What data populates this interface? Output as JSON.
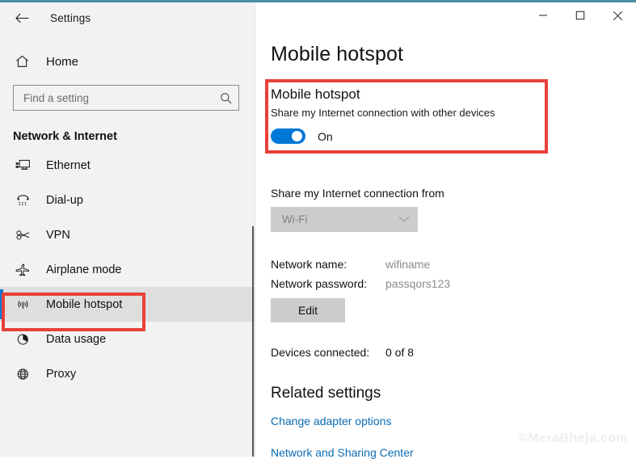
{
  "window": {
    "accent_color": "#4a90a4",
    "app_title": "Settings",
    "back_icon": "back-arrow-icon",
    "controls": {
      "minimize": "minimize-icon",
      "maximize": "maximize-icon",
      "close": "close-icon"
    }
  },
  "sidebar": {
    "home_label": "Home",
    "home_icon": "home-icon",
    "search": {
      "placeholder": "Find a setting",
      "value": "",
      "icon": "search-icon"
    },
    "section_title": "Network & Internet",
    "items": [
      {
        "label": "Ethernet",
        "icon": "ethernet-icon",
        "selected": false
      },
      {
        "label": "Dial-up",
        "icon": "dialup-phone-icon",
        "selected": false
      },
      {
        "label": "VPN",
        "icon": "vpn-key-icon",
        "selected": false
      },
      {
        "label": "Airplane mode",
        "icon": "airplane-icon",
        "selected": false
      },
      {
        "label": "Mobile hotspot",
        "icon": "hotspot-signal-icon",
        "selected": true
      },
      {
        "label": "Data usage",
        "icon": "pie-chart-icon",
        "selected": false
      },
      {
        "label": "Proxy",
        "icon": "globe-icon",
        "selected": false
      }
    ]
  },
  "main": {
    "page_title": "Mobile hotspot",
    "hotspot": {
      "title": "Mobile hotspot",
      "subtitle": "Share my Internet connection with other devices",
      "toggle_state": "On",
      "toggle_on": true,
      "toggle_color": "#0078d7"
    },
    "share_from": {
      "label": "Share my Internet connection from",
      "selected": "Wi-Fi",
      "chevron_icon": "chevron-down-icon",
      "disabled": true
    },
    "network": {
      "name_label": "Network name:",
      "name_value": "wifiname",
      "password_label": "Network password:",
      "password_value": "passqors123",
      "edit_label": "Edit"
    },
    "devices": {
      "label": "Devices connected:",
      "value": "0 of 8"
    },
    "related": {
      "title": "Related settings",
      "links": [
        "Change adapter options",
        "Network and Sharing Center"
      ]
    }
  },
  "annotations": {
    "color": "#e8403a",
    "boxes": [
      "sidebar-mobile-hotspot",
      "mobile-hotspot-toggle-section"
    ]
  },
  "watermark": "©MeraBheja.com"
}
